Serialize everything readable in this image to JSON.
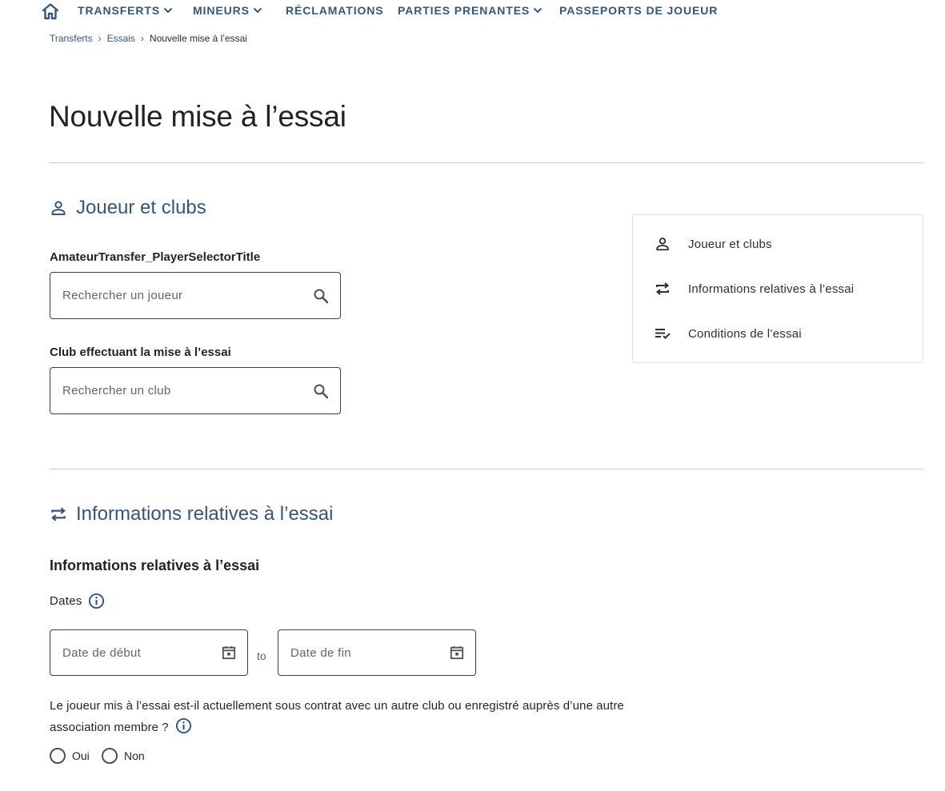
{
  "nav": {
    "items": [
      {
        "label": "TRANSFERTS",
        "dropdown": true
      },
      {
        "label": "MINEURS",
        "dropdown": true
      },
      {
        "label": "RÉCLAMATIONS",
        "dropdown": false
      },
      {
        "label": "PARTIES PRENANTES",
        "dropdown": true
      },
      {
        "label": "PASSEPORTS DE JOUEUR",
        "dropdown": false
      }
    ]
  },
  "breadcrumb": {
    "items": [
      "Transferts",
      "Essais"
    ],
    "current": "Nouvelle mise à l’essai"
  },
  "page": {
    "title": "Nouvelle mise à l’essai"
  },
  "section_player": {
    "title": "Joueur et clubs",
    "player_label": "AmateurTransfer_PlayerSelectorTitle",
    "player_placeholder": "Rechercher un joueur",
    "club_label": "Club effectuant la mise à l’essai",
    "club_placeholder": "Rechercher un club"
  },
  "toc": {
    "items": [
      {
        "label": "Joueur et clubs",
        "icon": "person-icon"
      },
      {
        "label": "Informations relatives à l’essai",
        "icon": "swap-icon"
      },
      {
        "label": "Conditions de l’essai",
        "icon": "checklist-icon"
      }
    ]
  },
  "section_info": {
    "title": "Informations relatives à l’essai",
    "subtitle": "Informations relatives à l’essai",
    "dates_label": "Dates",
    "start_placeholder": "Date de début",
    "to_text": "to",
    "end_placeholder": "Date de fin",
    "question": "Le joueur mis à l’essai est-il actuellement sous contrat avec un autre club ou enregistré auprès d’une autre association membre ?",
    "options": [
      "Oui",
      "Non"
    ]
  },
  "colors": {
    "accent": "#34557f",
    "text": "#1f2329",
    "border": "#3a3f45",
    "divider": "#c7c9cc"
  }
}
